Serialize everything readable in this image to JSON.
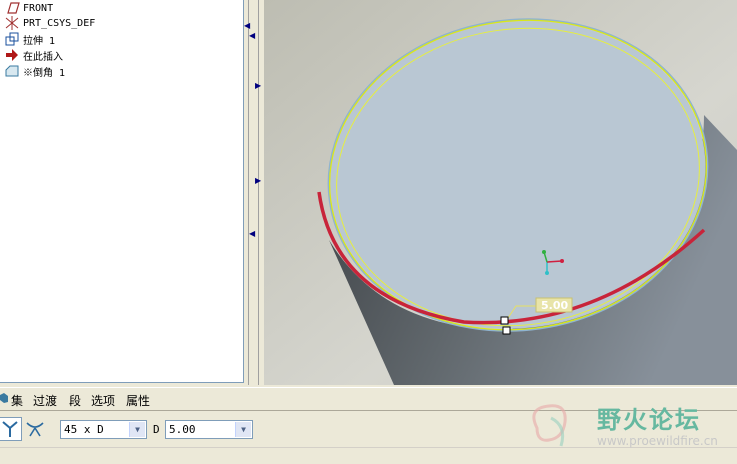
{
  "model_tree": {
    "items": [
      {
        "label": "FRONT",
        "icon": "datum-plane-icon"
      },
      {
        "label": "PRT_CSYS_DEF",
        "icon": "coordinate-system-icon"
      },
      {
        "label": "拉伸 1",
        "icon": "extrude-icon"
      },
      {
        "label": "在此插入",
        "icon": "insert-here-arrow-icon"
      },
      {
        "label": "※倒角 1",
        "icon": "chamfer-icon"
      }
    ]
  },
  "viewport": {
    "dimension_value": "5.00",
    "colors": {
      "background": "#cfcfc6",
      "cylinder_face": "#b9c7d3",
      "cylinder_side": "#5c6368",
      "highlight_edge": "#d8e81a",
      "selected_edge": "#c8243a"
    }
  },
  "dashboard": {
    "tabs": [
      "集",
      "过渡",
      "段",
      "选项",
      "属性"
    ],
    "scheme_dropdown": "45 x D",
    "d_label": "D",
    "d_value": "5.00"
  },
  "watermark": {
    "title": "野火论坛",
    "url": "www.proewildfire.cn"
  }
}
